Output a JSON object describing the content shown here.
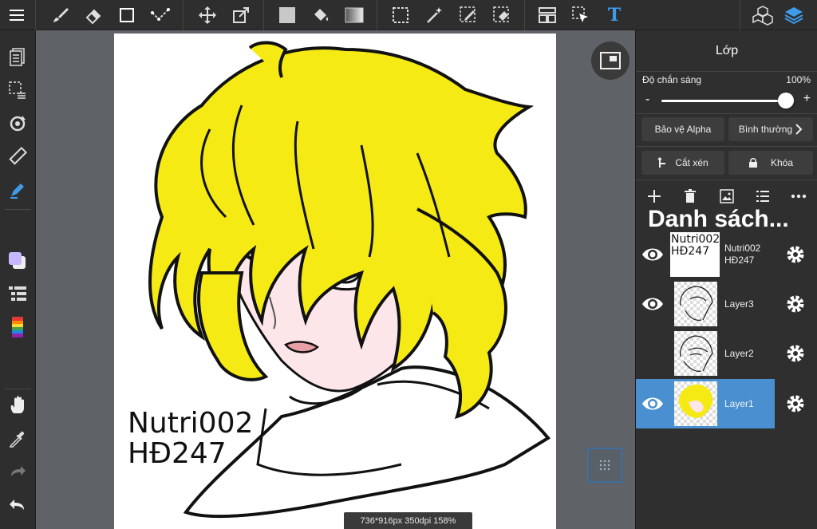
{
  "toolbar": {
    "left_tools": [
      "menu-icon",
      "brush-icon",
      "eraser-icon",
      "shape-icon",
      "select-nodes-icon",
      "move-icon",
      "transform-icon"
    ],
    "fill_tools": [
      "fill-color-swatch",
      "bucket-icon",
      "gradient-icon"
    ],
    "select_tools": [
      "marquee-icon",
      "magic-wand-icon",
      "select-pen-icon",
      "select-eraser-icon",
      "snap-icon",
      "object-select-icon",
      "text-icon"
    ],
    "right_tools": [
      "materials-icon",
      "layers-icon"
    ],
    "text_tool_glyph": "T"
  },
  "sidebar": {
    "items": [
      "pages-icon",
      "selection-icon",
      "rotate-icon",
      "ruler-icon",
      "pen-icon",
      "color-icon",
      "list-icon",
      "palette-icon",
      "hand-icon",
      "eyedropper-icon",
      "redo-icon",
      "undo-icon"
    ]
  },
  "canvas": {
    "signature_line1": "Nutri002",
    "signature_line2": "HĐ247",
    "status": "736*916px 350dpi 158%"
  },
  "panel": {
    "title": "Lớp",
    "opacity_label": "Độ chắn sáng",
    "opacity_value": "100%",
    "opacity_level": 100,
    "minus": "-",
    "plus": "+",
    "alpha_lock": "Bảo vệ Alpha",
    "blend_mode": "Bình thường",
    "clipping": "Cắt xén",
    "lock": "Khóa",
    "list_title": "Danh sách...",
    "layers": [
      {
        "name": "Nutri002\nHĐ247",
        "thumb_text": "Nutri002\nHĐ247",
        "visible": true,
        "selected": false
      },
      {
        "name": "Layer3",
        "visible": true,
        "selected": false
      },
      {
        "name": "Layer2",
        "visible": false,
        "selected": false
      },
      {
        "name": "Layer1",
        "visible": true,
        "selected": true
      }
    ]
  },
  "colors": {
    "accent": "#4a90d0",
    "hair": "#f5ea14",
    "skin": "#fde6ea"
  }
}
